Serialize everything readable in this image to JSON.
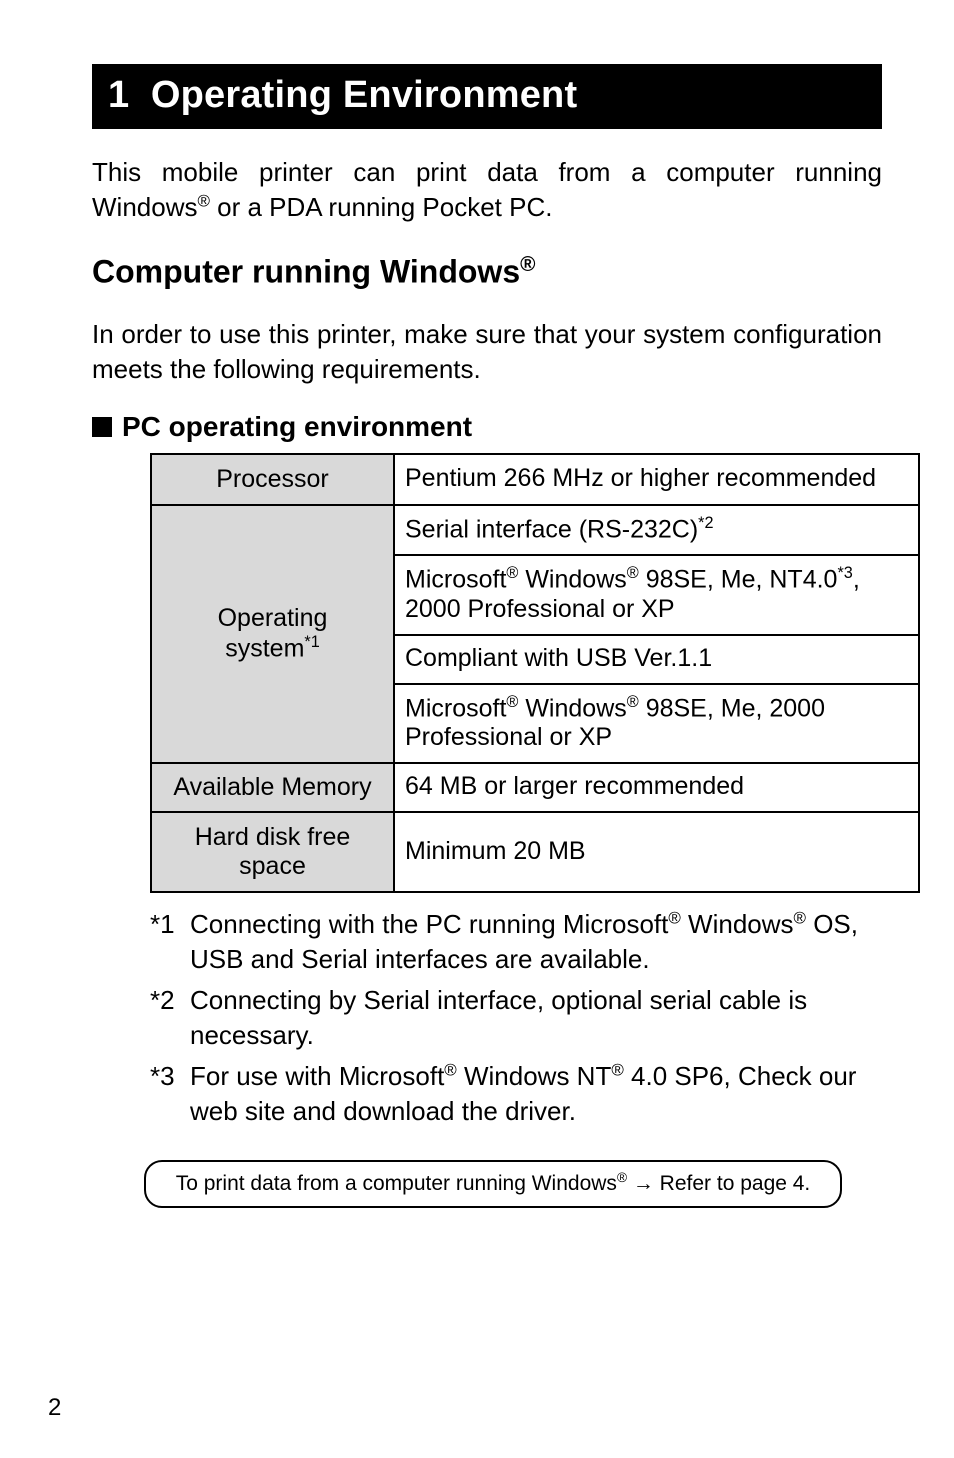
{
  "chapter": {
    "number": "1",
    "title": "Operating Environment"
  },
  "intro": {
    "part1": "This mobile printer can print data from a computer running Windows",
    "sup1": "®",
    "part2": " or a PDA running Pocket PC."
  },
  "section2": {
    "title_prefix": "Computer running Windows",
    "title_sup": "®"
  },
  "section2_body": "In order to use this printer, make sure that your system configuration meets the following requirements.",
  "subhead": "PC operating environment",
  "table": {
    "rows": {
      "processor": {
        "label": "Processor",
        "value": "Pentium 266 MHz or higher recommended"
      },
      "os": {
        "label_line1": "Operating",
        "label_line2_pre": "system",
        "label_line2_sup": "*1",
        "serial_pre": "Serial interface (RS-232C)",
        "serial_sup": "*2",
        "r2_a": "Microsoft",
        "r2_sup1": "®",
        "r2_b": " Windows",
        "r2_sup2": "®",
        "r2_c": " 98SE, Me, NT4.0",
        "r2_sup3": "*3",
        "r2_d": ", 2000 Professional or XP",
        "usb": "Compliant with USB Ver.1.1",
        "r4_a": "Microsoft",
        "r4_sup1": "®",
        "r4_b": " Windows",
        "r4_sup2": "®",
        "r4_c": " 98SE, Me, 2000 Professional or XP"
      },
      "memory": {
        "label": "Available Memory",
        "value": "64 MB or larger recommended"
      },
      "hdd": {
        "label_line1": "Hard disk free",
        "label_line2": "space",
        "value": "Minimum 20 MB"
      }
    }
  },
  "footnotes": {
    "f1": {
      "key": "*1",
      "a": "Connecting with the PC running Microsoft",
      "s1": "®",
      "b": " Windows",
      "s2": "®",
      "c": " OS, USB and Serial interfaces are available."
    },
    "f2": {
      "key": "*2",
      "text": "Connecting by Serial interface, optional serial cable is necessary."
    },
    "f3": {
      "key": "*3",
      "a": "For use with Microsoft",
      "s1": "®",
      "b": " Windows NT",
      "s2": "®",
      "c": " 4.0 SP6, Check our web site and download the driver."
    }
  },
  "note": {
    "a": "To print data from a computer running Windows",
    "s1": "®",
    "arrow": " → ",
    "b": "Refer to page 4."
  },
  "page_number": "2"
}
